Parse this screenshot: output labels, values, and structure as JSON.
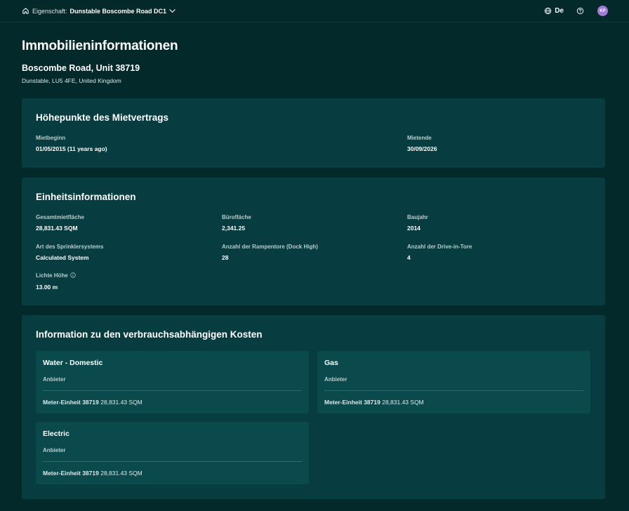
{
  "topbar": {
    "property_label": "Eigenschaft:",
    "property_value": "Dunstable Boscombe Road DC1",
    "language": "De",
    "avatar_initials": "KP"
  },
  "header": {
    "title": "Immobilieninformationen",
    "unit": "Boscombe Road, Unit 38719",
    "address": "Dunstable, LU5 4FE, United Kingdom"
  },
  "lease": {
    "title": "Höhepunkte des Mietvertrags",
    "start_label": "Mietbeginn",
    "start_value": "01/05/2015 (11 years ago)",
    "end_label": "Mietende",
    "end_value": "30/09/2026"
  },
  "unit_info": {
    "title": "Einheitsinformationen",
    "fields": [
      {
        "label": "Gesamtmietfläche",
        "value": "28,831.43 SQM"
      },
      {
        "label": "Bürofläche",
        "value": "2,341.25"
      },
      {
        "label": "Baujahr",
        "value": "2014"
      },
      {
        "label": "Art des Sprinklersystems",
        "value": "Calculated System"
      },
      {
        "label": "Anzahl der Rampentore (Dock High)",
        "value": "28"
      },
      {
        "label": "Anzahl der Drive-in-Tore",
        "value": "4"
      },
      {
        "label": "Lichte Höhe",
        "value": "13.00 m"
      }
    ]
  },
  "utilities": {
    "title": "Information zu den verbrauchsabhängigen Kosten",
    "items": [
      {
        "name": "Water - Domestic",
        "provider_label": "Anbieter",
        "meter_label": "Meter-Einheit 38719",
        "meter_value": "28,831.43 SQM"
      },
      {
        "name": "Gas",
        "provider_label": "Anbieter",
        "meter_label": "Meter-Einheit 38719",
        "meter_value": "28,831.43 SQM"
      },
      {
        "name": "Electric",
        "provider_label": "Anbieter",
        "meter_label": "Meter-Einheit 38719",
        "meter_value": "28,831.43 SQM"
      }
    ]
  },
  "colors": {
    "background": "#03292b",
    "card": "#073d40",
    "subcard": "#0b4a4c",
    "avatar": "#a07ad6"
  }
}
